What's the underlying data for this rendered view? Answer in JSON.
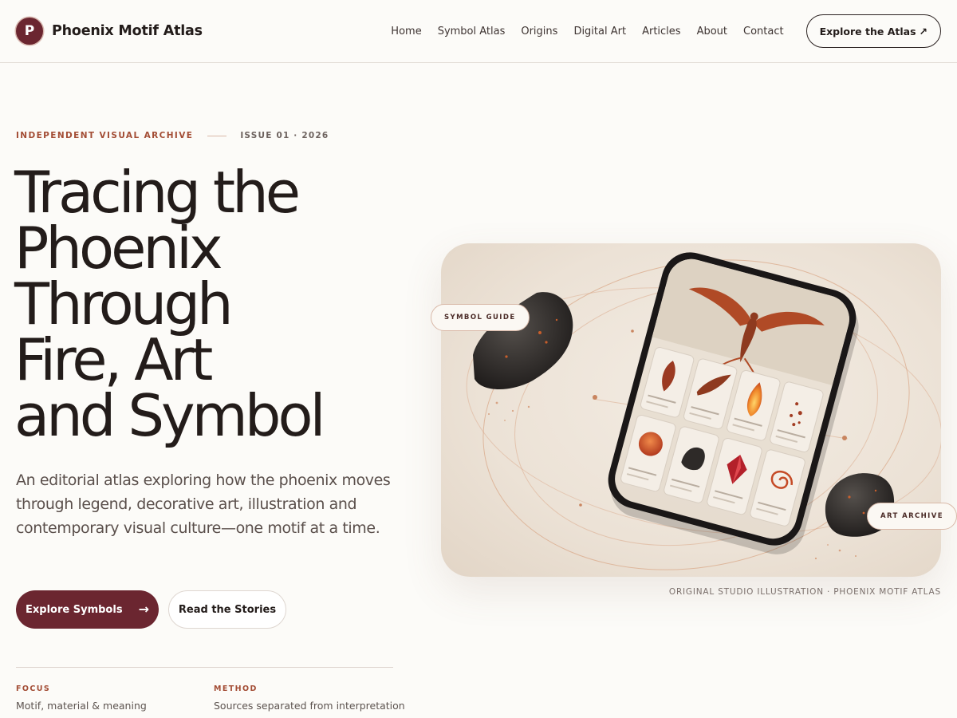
{
  "brand": {
    "mark": "P",
    "name": "Phoenix Motif Atlas"
  },
  "nav": [
    "Home",
    "Symbol Atlas",
    "Origins",
    "Digital Art",
    "Articles",
    "About",
    "Contact"
  ],
  "header_cta": {
    "label": "Explore the Atlas",
    "icon": "↗"
  },
  "eyebrow": {
    "label": "INDEPENDENT VISUAL ARCHIVE",
    "issue": "ISSUE 01 · 2026"
  },
  "headline": [
    "Tracing the",
    "Phoenix",
    "Through",
    "Fire, Art",
    "and Symbol"
  ],
  "lede": "An editorial atlas exploring how the phoenix moves through legend, decorative art, illustration and contemporary visual culture—one motif at a time.",
  "buttons": {
    "primary": "Explore Symbols",
    "primary_icon": "→",
    "secondary": "Read the Stories"
  },
  "meta": [
    {
      "label": "FOCUS",
      "value": "Motif, material & meaning"
    },
    {
      "label": "METHOD",
      "value": "Sources separated from interpretation"
    }
  ],
  "hero": {
    "pill_left": "SYMBOL GUIDE",
    "pill_right": "ART ARCHIVE",
    "caption": "ORIGINAL STUDIO ILLUSTRATION · PHOENIX MOTIF ATLAS"
  },
  "colors": {
    "accent": "#6b2630",
    "eyebrow": "#a34d35",
    "background": "#fcfbf8",
    "text": "#231c1a"
  }
}
